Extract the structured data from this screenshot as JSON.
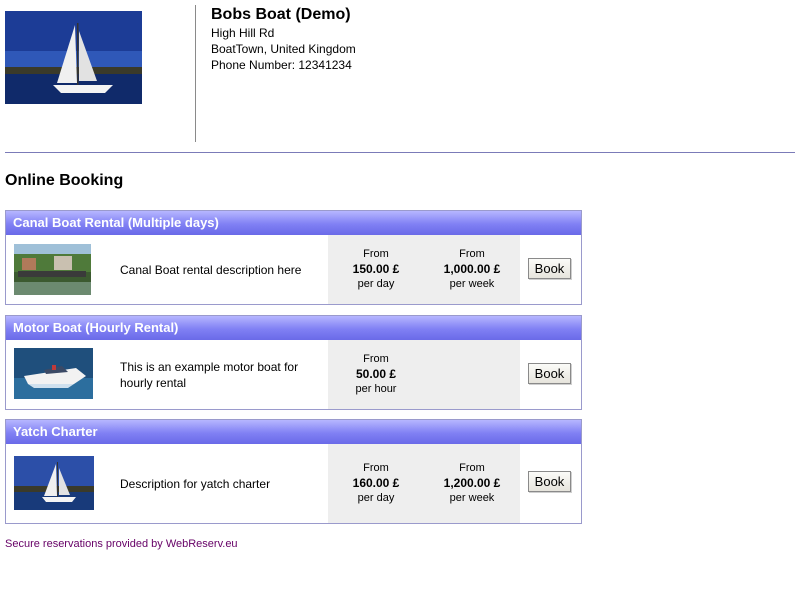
{
  "business": {
    "name": "Bobs Boat (Demo)",
    "address_line1": "High Hill Rd",
    "address_line2": "BoatTown, United Kingdom",
    "phone": "Phone Number: 12341234"
  },
  "page": {
    "section_title": "Online Booking"
  },
  "listings": [
    {
      "title": "Canal Boat Rental (Multiple days)",
      "description": "Canal Boat rental description here",
      "prices": [
        {
          "from": "From",
          "amount": "150.00 £",
          "unit": "per day"
        },
        {
          "from": "From",
          "amount": "1,000.00 £",
          "unit": "per week"
        }
      ],
      "book_label": "Book"
    },
    {
      "title": "Motor Boat (Hourly Rental)",
      "description": "This is an example motor boat for hourly rental",
      "prices": [
        {
          "from": "From",
          "amount": "50.00 £",
          "unit": "per hour"
        }
      ],
      "book_label": "Book"
    },
    {
      "title": "Yatch Charter",
      "description": "Description for yatch charter",
      "prices": [
        {
          "from": "From",
          "amount": "160.00 £",
          "unit": "per day"
        },
        {
          "from": "From",
          "amount": "1,200.00 £",
          "unit": "per week"
        }
      ],
      "book_label": "Book"
    }
  ],
  "footer": {
    "prefix": "Secure reservations provided by ",
    "link_text": "WebReserv.eu"
  },
  "colors": {
    "bar": "#8080f4",
    "border": "#9a9acc",
    "footer": "#660066",
    "price_bg": "#eeeeee"
  }
}
